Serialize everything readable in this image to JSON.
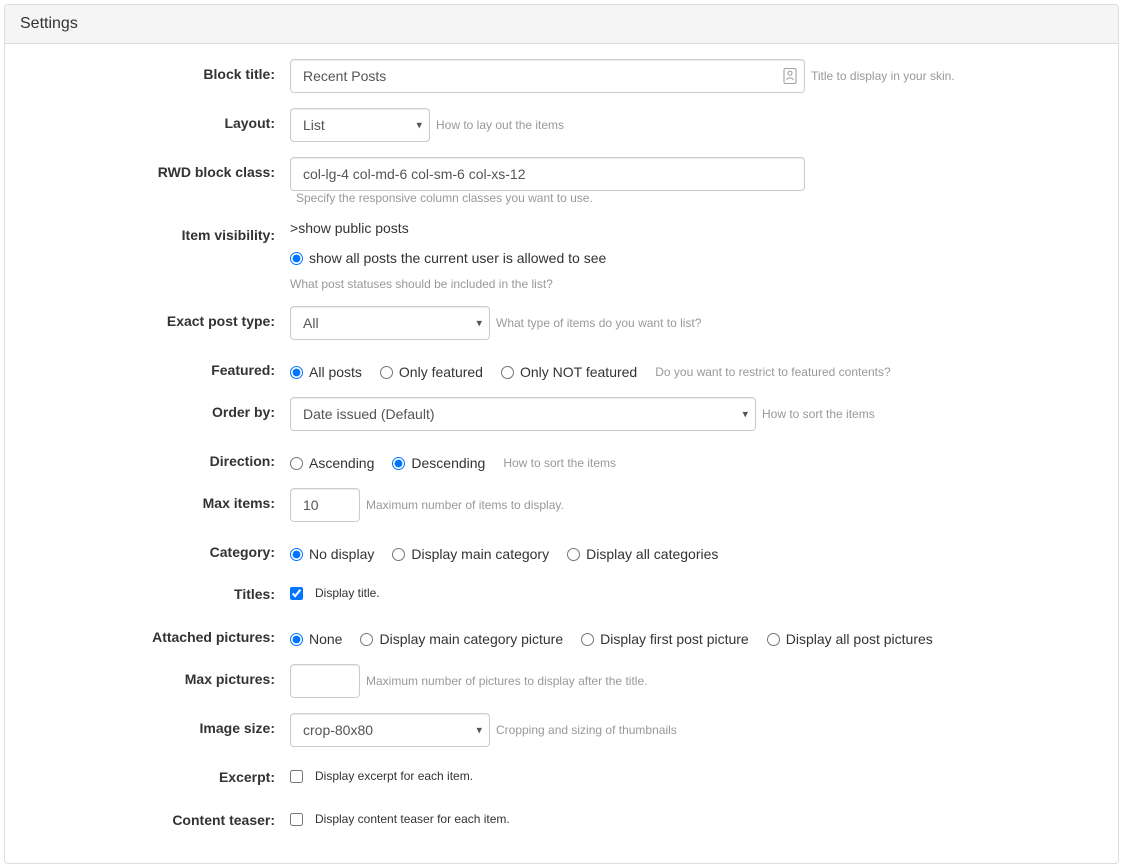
{
  "panel_title": "Settings",
  "fields": {
    "block_title": {
      "label": "Block title:",
      "value": "Recent Posts",
      "hint": "Title to display in your skin."
    },
    "layout": {
      "label": "Layout:",
      "value": "List",
      "hint": "How to lay out the items"
    },
    "rwd_class": {
      "label": "RWD block class:",
      "value": "col-lg-4 col-md-6 col-sm-6 col-xs-12",
      "hint": "Specify the responsive column classes you want to use."
    },
    "item_visibility": {
      "label": "Item visibility:",
      "option1": "show public posts",
      "option2": "show all posts the current user is allowed to see",
      "hint": "What post statuses should be included in the list?"
    },
    "exact_post_type": {
      "label": "Exact post type:",
      "value": "All",
      "hint": "What type of items do you want to list?"
    },
    "featured": {
      "label": "Featured:",
      "option1": "All posts",
      "option2": "Only featured",
      "option3": "Only NOT featured",
      "hint": "Do you want to restrict to featured contents?"
    },
    "order_by": {
      "label": "Order by:",
      "value": "Date issued (Default)",
      "hint": "How to sort the items"
    },
    "direction": {
      "label": "Direction:",
      "option1": "Ascending",
      "option2": "Descending",
      "hint": "How to sort the items"
    },
    "max_items": {
      "label": "Max items:",
      "value": "10",
      "hint": "Maximum number of items to display."
    },
    "category": {
      "label": "Category:",
      "option1": "No display",
      "option2": "Display main category",
      "option3": "Display all categories"
    },
    "titles": {
      "label": "Titles:",
      "checkbox_label": "Display title."
    },
    "attached_pictures": {
      "label": "Attached pictures:",
      "option1": "None",
      "option2": "Display main category picture",
      "option3": "Display first post picture",
      "option4": "Display all post pictures"
    },
    "max_pictures": {
      "label": "Max pictures:",
      "value": "",
      "hint": "Maximum number of pictures to display after the title."
    },
    "image_size": {
      "label": "Image size:",
      "value": "crop-80x80",
      "hint": "Cropping and sizing of thumbnails"
    },
    "excerpt": {
      "label": "Excerpt:",
      "checkbox_label": "Display excerpt for each item."
    },
    "content_teaser": {
      "label": "Content teaser:",
      "checkbox_label": "Display content teaser for each item."
    }
  }
}
